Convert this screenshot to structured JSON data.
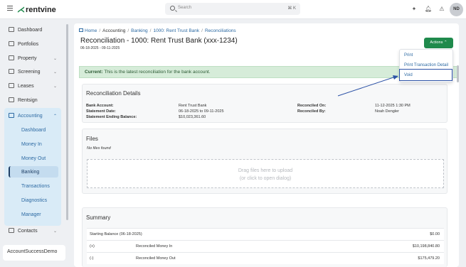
{
  "brand": {
    "name": "rentvine"
  },
  "search": {
    "placeholder": "Search",
    "shortcut": "⌘ K"
  },
  "user": {
    "initials": "ND"
  },
  "sidebar": {
    "items": [
      {
        "label": "Dashboard",
        "icon": "grid-icon"
      },
      {
        "label": "Portfolios",
        "icon": "folder-icon"
      },
      {
        "label": "Property",
        "icon": "building-icon"
      },
      {
        "label": "Screening",
        "icon": "screening-icon"
      },
      {
        "label": "Leases",
        "icon": "document-icon"
      },
      {
        "label": "Rentsign",
        "icon": "pen-icon"
      },
      {
        "label": "Accounting",
        "icon": "dollar-icon"
      },
      {
        "label": "Contacts",
        "icon": "contacts-icon"
      }
    ],
    "accounting_sub": [
      "Dashboard",
      "Money In",
      "Money Out",
      "Banking",
      "Transactions",
      "Diagnostics",
      "Manager"
    ],
    "active_sub": "Banking",
    "account_name": "AccountSuccessDemo"
  },
  "breadcrumb": {
    "home": "Home",
    "accounting": "Accounting",
    "banking": "Banking",
    "bank": "1000: Rent Trust Bank",
    "recon": "Reconciliations"
  },
  "page": {
    "title": "Reconciliation - 1000: Rent Trust Bank (xxx-1234)",
    "date_range": "06-18-2025 - 09-11-2025"
  },
  "actions": {
    "label": "Actions",
    "menu": [
      "Print",
      "Print Transaction Detail",
      "Void"
    ]
  },
  "alert": {
    "strong": "Current:",
    "text": " This is the latest reconciliation for the bank account."
  },
  "details": {
    "title": "Reconciliation Details",
    "left_labels": [
      "Bank Account:",
      "Statement Date:",
      "Statement Ending Balance:"
    ],
    "left_values": [
      "Rent Trust Bank",
      "06-18-2025 to 09-11-2025",
      "$10,023,361.60"
    ],
    "right_labels": [
      "Reconciled On:",
      "Reconciled By:"
    ],
    "right_values": [
      "11-12-2025 1:30 PM",
      "Noah Dengler"
    ]
  },
  "files": {
    "title": "Files",
    "empty": "No files found",
    "drop_line1": "Drag files here to upload",
    "drop_line2": "(or click to open dialog)"
  },
  "summary": {
    "title": "Summary",
    "rows": [
      {
        "sign": "",
        "label": "Starting Balance (06-18-2025)",
        "amount": "$0.00"
      },
      {
        "sign": "(+)",
        "label": "Reconciled Money In",
        "amount": "$10,198,840.80"
      },
      {
        "sign": "(-)",
        "label": "Reconciled Money Out",
        "amount": "$175,479.20"
      }
    ]
  },
  "colors": {
    "accent": "#1f8a4c",
    "link": "#2d6aa3",
    "alert_bg": "#d6ecd9"
  }
}
